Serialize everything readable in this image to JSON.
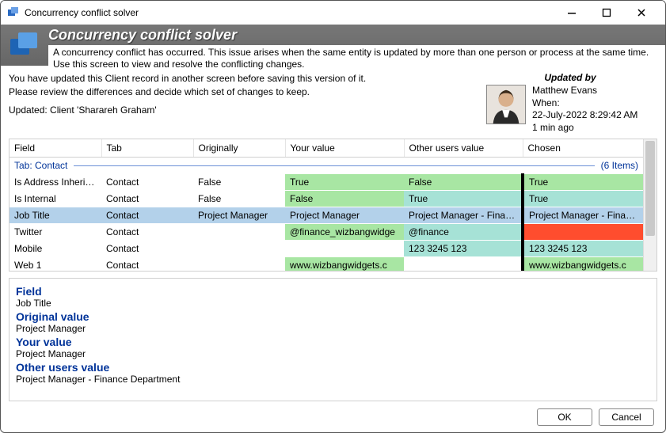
{
  "window": {
    "title": "Concurrency conflict solver"
  },
  "banner": {
    "title": "Concurrency conflict solver",
    "description": "A concurrency conflict has occurred.  This issue arises when the same entity is updated by more than one person or process at the same time.  Use this screen to view and resolve the conflicting changes."
  },
  "info": {
    "line1": "You have updated this Client record in another screen before saving this version of it.",
    "line2": "Please review the differences and decide which set of changes to keep.",
    "line3": "Updated: Client 'Sharareh Graham'"
  },
  "updated_by": {
    "label": "Updated by",
    "name": "Matthew Evans",
    "when_label": "When:",
    "when_value": "22-July-2022 8:29:42 AM",
    "relative": "1 min ago"
  },
  "grid": {
    "headers": {
      "field": "Field",
      "tab": "Tab",
      "originally": "Originally",
      "your_value": "Your value",
      "other_value": "Other users value",
      "chosen": "Chosen"
    },
    "group": {
      "label": "Tab: Contact",
      "count_label": "(6 Items)"
    },
    "rows": [
      {
        "field": "Is Address Inherite...",
        "tab": "Contact",
        "originally": "False",
        "your_value": "True",
        "your_cls": "cell-green",
        "other_value": "False",
        "other_cls": "cell-green",
        "chosen": "True",
        "chosen_cls": "cell-green chosen-mark"
      },
      {
        "field": "Is Internal",
        "tab": "Contact",
        "originally": "False",
        "your_value": "False",
        "your_cls": "cell-green",
        "other_value": "True",
        "other_cls": "cell-bluegreen",
        "chosen": "True",
        "chosen_cls": "cell-bluegreen chosen-mark"
      },
      {
        "selected": true,
        "field": "Job Title",
        "tab": "Contact",
        "originally": "Project Manager",
        "your_value": "Project Manager",
        "your_cls": "",
        "other_value": "Project Manager - Finan...",
        "other_cls": "",
        "chosen": "Project Manager - Finan...",
        "chosen_cls": "chosen-mark"
      },
      {
        "field": "Twitter",
        "tab": "Contact",
        "originally": "",
        "your_value": "@finance_wizbangwidge",
        "your_cls": "cell-green",
        "other_value": "@finance",
        "other_cls": "cell-bluegreen",
        "chosen": "",
        "chosen_cls": "cell-red chosen-mark"
      },
      {
        "field": "Mobile",
        "tab": "Contact",
        "originally": "",
        "your_value": "",
        "your_cls": "",
        "other_value": "123 3245 123",
        "other_cls": "cell-bluegreen",
        "chosen": "123 3245 123",
        "chosen_cls": "cell-bluegreen chosen-mark"
      },
      {
        "field": "Web 1",
        "tab": "Contact",
        "originally": "",
        "your_value": "www.wizbangwidgets.c",
        "your_cls": "cell-green",
        "other_value": "",
        "other_cls": "",
        "chosen": "www.wizbangwidgets.c",
        "chosen_cls": "cell-green chosen-mark"
      }
    ]
  },
  "detail": {
    "field_label": "Field",
    "field_value": "Job Title",
    "original_label": "Original value",
    "original_value": "Project Manager",
    "your_label": "Your value",
    "your_value": "Project Manager",
    "other_label": "Other users value",
    "other_value": "Project Manager - Finance Department"
  },
  "buttons": {
    "ok": "OK",
    "cancel": "Cancel"
  }
}
